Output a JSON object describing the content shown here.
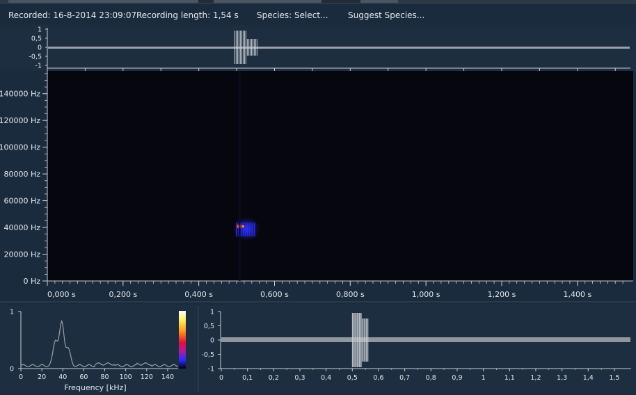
{
  "header": {
    "recorded": "Recorded: 16-8-2014 23:09:07",
    "length": "Recording length: 1,54 s",
    "species": "Species: Select...",
    "suggest": "Suggest Species..."
  },
  "waveform_top": {
    "y_ticks": [
      "1",
      "0,5",
      "0",
      "-0,5",
      "-1"
    ],
    "burst_start_s": 0.495,
    "burst_end_s": 0.555
  },
  "spectrogram": {
    "y_ticks": [
      "140000 Hz",
      "120000 Hz",
      "100000 Hz",
      "80000 Hz",
      "60000 Hz",
      "40000 Hz",
      "20000 Hz",
      "0 Hz"
    ],
    "x_ticks": [
      "0,000 s",
      "0,200 s",
      "0,400 s",
      "0,600 s",
      "0,800 s",
      "1,000 s",
      "1,200 s",
      "1,400 s"
    ],
    "call_time_s": 0.52,
    "call_freq_hz": 40000,
    "colors": {
      "background": "#06060f",
      "hot": "#ff5a1e",
      "cool": "#2a2cff"
    }
  },
  "spectrum": {
    "x_label": "Frequency [kHz]",
    "x_ticks": [
      "0",
      "20",
      "40",
      "60",
      "80",
      "100",
      "120",
      "140"
    ],
    "y_ticks": [
      "1",
      "0"
    ],
    "peaks_khz": [
      33,
      39,
      45
    ],
    "peak_levels": [
      0.45,
      0.75,
      0.3
    ]
  },
  "waveform_bottom": {
    "y_ticks": [
      "1",
      "0,5",
      "0",
      "-0,5",
      "-1"
    ],
    "x_ticks": [
      "0",
      "0,1",
      "0,2",
      "0,3",
      "0,4",
      "0,5",
      "0,6",
      "0,7",
      "0,8",
      "0,9",
      "1",
      "1,1",
      "1,2",
      "1,3",
      "1,4",
      "1,5"
    ],
    "burst_start_s": 0.5,
    "burst_end_s": 0.56
  }
}
